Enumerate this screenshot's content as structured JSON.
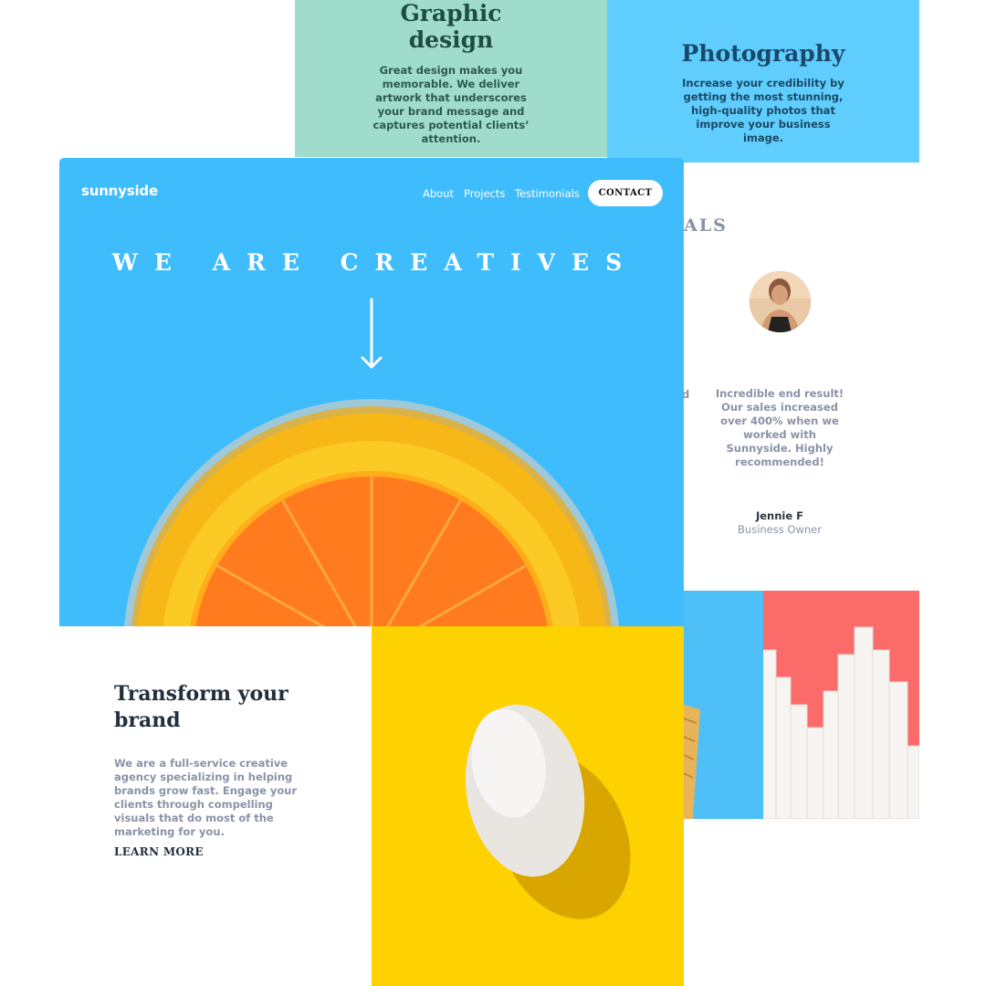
{
  "colors": {
    "hero_bg": "#3ebcfc",
    "graphic_bg": "#a0dccb",
    "photo_bg": "#5fcdfd",
    "egg_bg": "#fed100",
    "sugar_bg": "#fb6b6a",
    "heading_dark": "#22303d",
    "muted_text": "#8a92a5"
  },
  "services": {
    "graphic": {
      "title": "Graphic design",
      "text": "Great design makes you memorable. We deliver artwork that underscores your brand message and captures potential clients’ attention."
    },
    "photography": {
      "title": "Photography",
      "text": "Increase your credibility by getting the most stunning, high-quality photos that improve your business image."
    }
  },
  "testimonials": {
    "heading_fragment": "ALS",
    "cut_text_fragment": "d",
    "quote": "Incredible end result! Our sales increased over 400% when we worked with Sunnyside. Highly recommended!",
    "name": "Jennie F",
    "role": "Business Owner"
  },
  "header": {
    "logo": "sunnyside",
    "nav": [
      "About",
      "Projects",
      "Testimonials"
    ],
    "contact": "CONTACT"
  },
  "hero": {
    "title": "WE ARE CREATIVES",
    "arrow_icon": "arrow-down-icon"
  },
  "transform": {
    "title": "Transform your brand",
    "text": "We are a full-service creative agency specializing in helping brands grow fast. Engage your clients through compelling visuals that do most of the marketing for you.",
    "cta": "LEARN MORE"
  }
}
